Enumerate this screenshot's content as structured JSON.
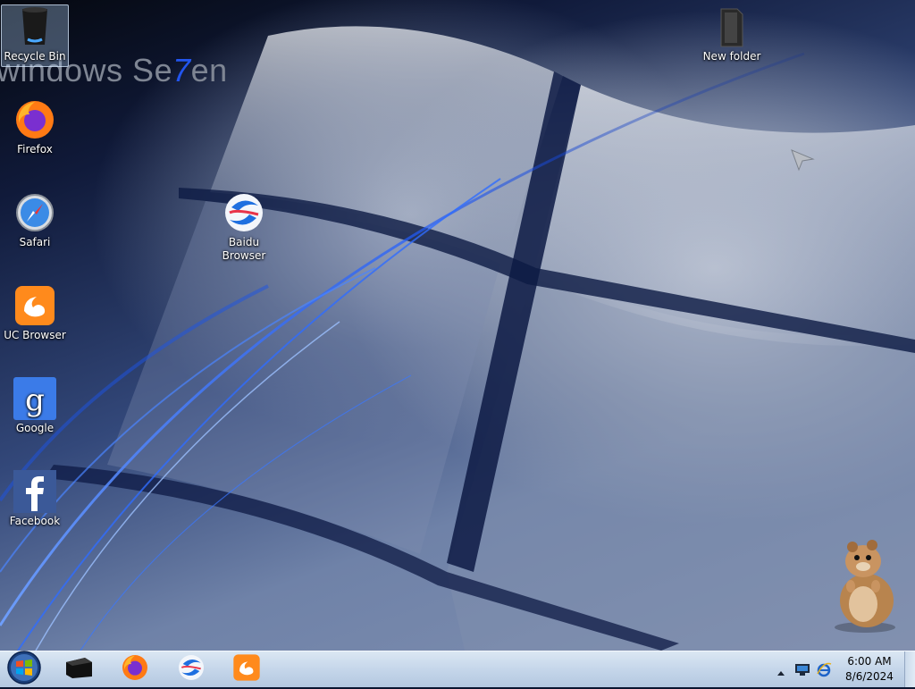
{
  "wallpaper": {
    "wordmark_prefix": "windows Se",
    "wordmark_seven": "7",
    "wordmark_suffix": "en",
    "colors": {
      "base": "#1a2a55",
      "streak": "#2d6cff",
      "glass": "#c8ced9"
    }
  },
  "desktop_icons": [
    {
      "id": "recycle-bin",
      "label": "Recycle Bin",
      "icon": "trash-bin-icon",
      "selected": true
    },
    {
      "id": "firefox",
      "label": "Firefox",
      "icon": "firefox-icon"
    },
    {
      "id": "safari",
      "label": "Safari",
      "icon": "safari-compass-icon"
    },
    {
      "id": "uc-browser",
      "label": "UC Browser",
      "icon": "uc-browser-icon"
    },
    {
      "id": "google",
      "label": "Google",
      "icon": "google-g-icon"
    },
    {
      "id": "facebook",
      "label": "Facebook",
      "icon": "facebook-f-icon"
    },
    {
      "id": "baidu-browser",
      "label_line1": "Baidu",
      "label_line2": "Browser",
      "icon": "baidu-browser-icon"
    },
    {
      "id": "new-folder",
      "label": "New folder",
      "icon": "folder-icon"
    }
  ],
  "gadget": {
    "icon": "hamster-gadget-icon"
  },
  "taskbar": {
    "start_icon": "start-orb-icon",
    "pinned": [
      {
        "id": "explorer",
        "icon": "explorer-icon"
      },
      {
        "id": "firefox",
        "icon": "firefox-icon"
      },
      {
        "id": "baidu",
        "icon": "baidu-browser-icon"
      },
      {
        "id": "uc-browser",
        "icon": "uc-browser-icon"
      }
    ],
    "tray": {
      "show_hidden_icon": "up-arrow-icon",
      "network_icon": "network-monitor-icon",
      "ie_icon": "ie-icon",
      "time": "6:00 AM",
      "date": "8/6/2024"
    },
    "colors": {
      "bar": "#c5d6ea",
      "accent": "#1e4fa3"
    }
  }
}
